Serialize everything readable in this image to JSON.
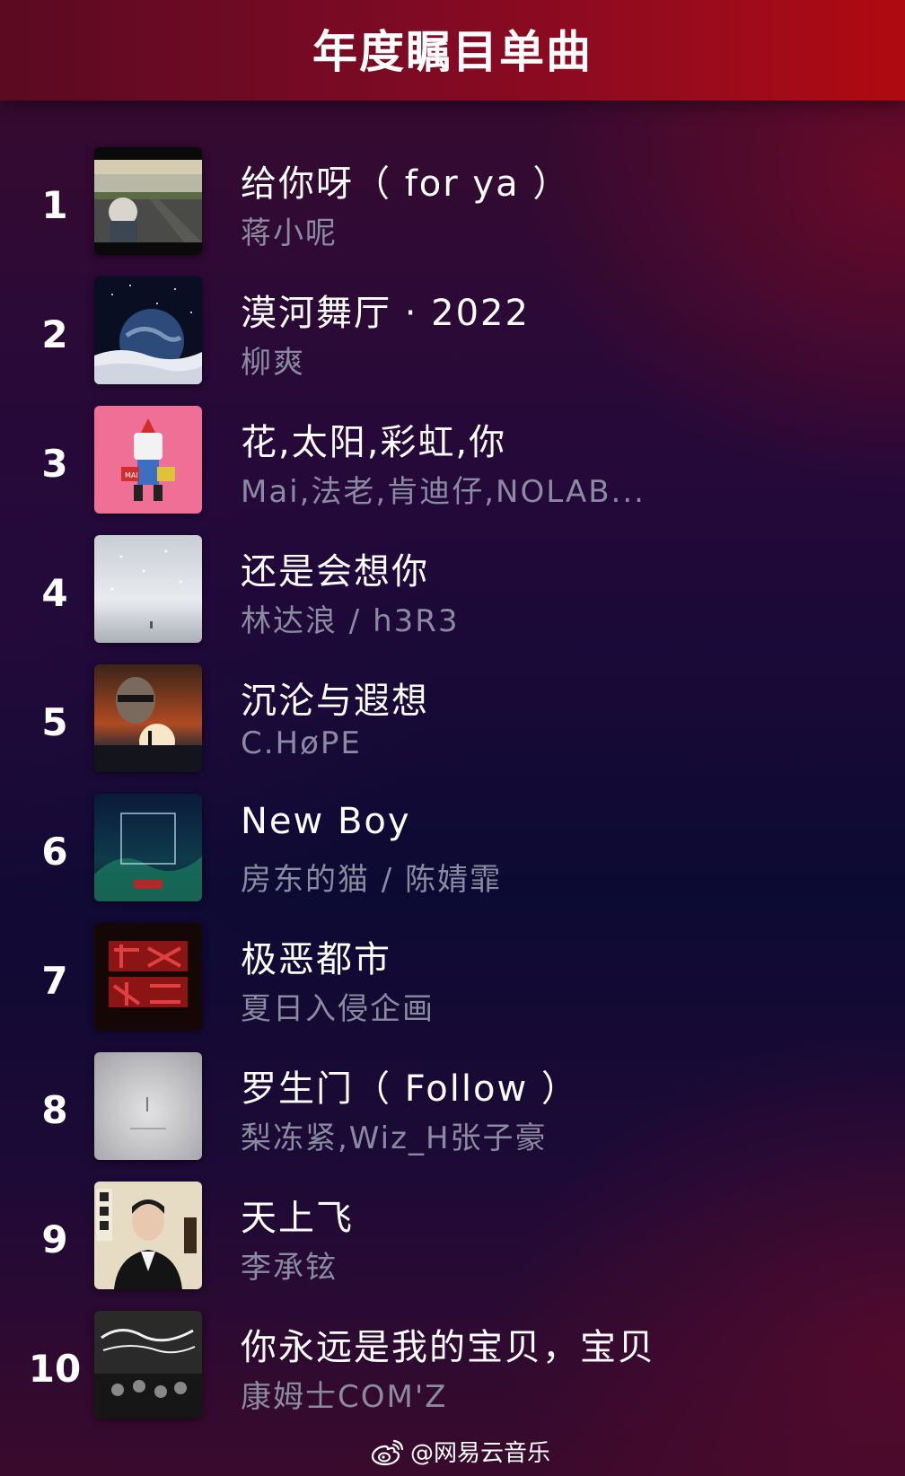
{
  "header": {
    "title": "年度瞩目单曲"
  },
  "songs": [
    {
      "rank": "1",
      "title": "给你呀（ for ya ）",
      "artist": "蒋小呢",
      "cover": "road-cover"
    },
    {
      "rank": "2",
      "title": "漠河舞厅 · 2022",
      "artist": "柳爽",
      "cover": "planet-cover"
    },
    {
      "rank": "3",
      "title": "花,太阳,彩虹,你",
      "artist": "Mai,法老,肯迪仔,NOLAB...",
      "cover": "robot-cover"
    },
    {
      "rank": "4",
      "title": "还是会想你",
      "artist": "林达浪 / h3R3",
      "cover": "snow-sky-cover"
    },
    {
      "rank": "5",
      "title": "沉沦与遐想",
      "artist": "C.HøPE",
      "cover": "sunset-face-cover"
    },
    {
      "rank": "6",
      "title": "New Boy",
      "artist": "房东的猫 / 陈婧霏",
      "cover": "treasure-singer-cover"
    },
    {
      "rank": "7",
      "title": "极恶都市",
      "artist": "夏日入侵企画",
      "cover": "red-city-cover"
    },
    {
      "rank": "8",
      "title": "罗生门（ Follow ）",
      "artist": "梨冻紧,Wiz_H张子豪",
      "cover": "grey-fog-cover"
    },
    {
      "rank": "9",
      "title": "天上飞",
      "artist": "李承铉",
      "cover": "portrait-cover"
    },
    {
      "rank": "10",
      "title": "你永远是我的宝贝，宝贝",
      "artist": "康姆士COM'Z",
      "cover": "band-cover"
    }
  ],
  "footer": {
    "handle": "@网易云音乐",
    "icon": "weibo-icon"
  },
  "colors": {
    "title": "#ffffff",
    "artist": "#8a8aa0",
    "header_red": "#9c0b1c"
  }
}
